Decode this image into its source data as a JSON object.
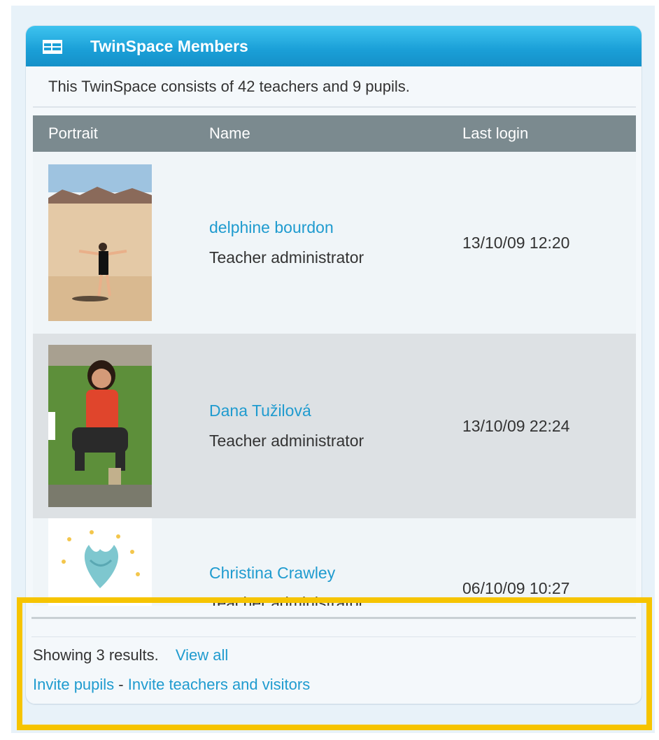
{
  "widget": {
    "title": "TwinSpace Members",
    "icon": "table-icon",
    "summary": "This TwinSpace consists of 42 teachers and 9 pupils."
  },
  "table": {
    "headers": [
      "Portrait",
      "Name",
      "Last login"
    ],
    "rows": [
      {
        "name": "delphine bourdon",
        "role": "Teacher administrator",
        "last_login": "13/10/09 12:20",
        "portrait": "photo-desert-person"
      },
      {
        "name": "Dana Tužilová",
        "role": "Teacher administrator",
        "last_login": "13/10/09 22:24",
        "portrait": "photo-woman-grass"
      },
      {
        "name": "Christina Crawley",
        "role": "Teacher administrator",
        "last_login": "06/10/09 10:27",
        "portrait": "photo-flower-sparkles"
      }
    ]
  },
  "footer": {
    "results_text": "Showing 3 results.",
    "view_all": "View all",
    "invite_pupils": "Invite pupils",
    "separator": " - ",
    "invite_teachers": "Invite teachers and visitors"
  },
  "colors": {
    "header_blue": "#1a9fd7",
    "link_blue": "#1f9bcf",
    "table_header_gray": "#7b8a8f",
    "highlight_yellow": "#f6c400"
  }
}
